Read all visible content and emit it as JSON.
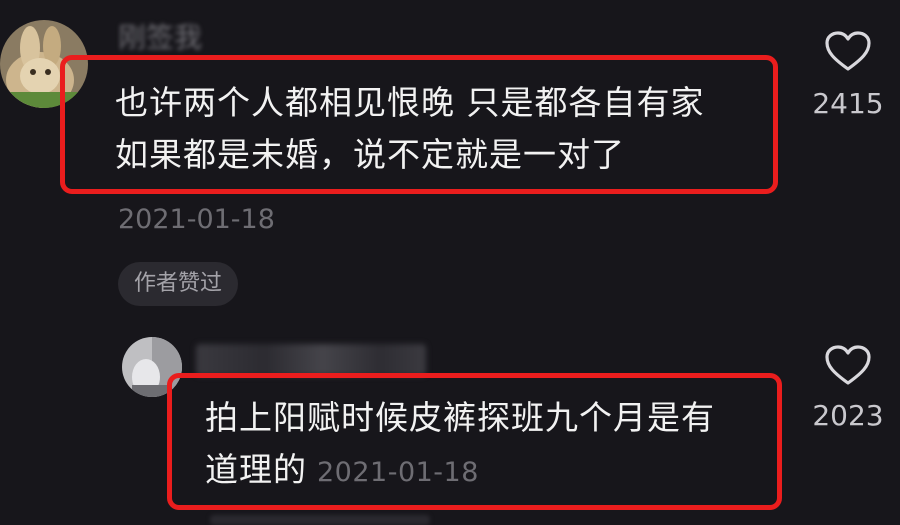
{
  "comments": [
    {
      "username": "刚签我",
      "text_line1": "也许两个人都相见恨晚 只是都各自有家",
      "text_line2": "如果都是未婚，说不定就是一对了",
      "date": "2021-01-18",
      "badge": "作者赞过",
      "likes": "2415",
      "like_icon": "heart-outline-icon"
    },
    {
      "username": "",
      "text_line1": "拍上阳赋时候皮裤探班九个月是有",
      "text_line2": "道理的",
      "date": "2021-01-18",
      "likes": "2023",
      "like_icon": "heart-outline-icon"
    }
  ],
  "colors": {
    "background": "#17161b",
    "highlight_border": "#ea1d1d",
    "text": "#f2f2f2",
    "muted": "#6e6d73"
  }
}
